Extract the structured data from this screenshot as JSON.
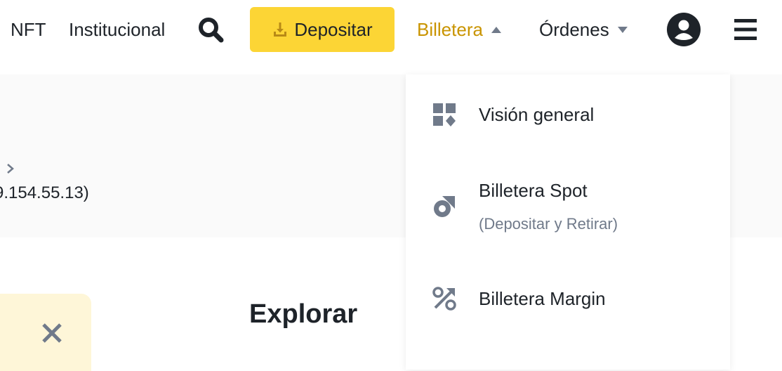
{
  "nav": {
    "nft": "NFT",
    "institutional": "Institucional",
    "deposit_label": "Depositar",
    "wallet": "Billetera",
    "orders": "Órdenes"
  },
  "background": {
    "ip_text": "9.154.55.13)"
  },
  "content": {
    "explore_title": "Explorar"
  },
  "dropdown": {
    "items": [
      {
        "label": "Visión general",
        "icon": "overview-grid-icon"
      },
      {
        "label": "Billetera Spot",
        "sub": "(Depositar y Retirar)",
        "icon": "spot-wallet-icon"
      },
      {
        "label": "Billetera Margin",
        "icon": "margin-percent-icon"
      }
    ]
  },
  "colors": {
    "accent_yellow": "#fcd535",
    "active_gold": "#c99400",
    "text_dark": "#1e2329",
    "text_muted": "#707a8a",
    "notice_bg": "#fef6d8"
  }
}
